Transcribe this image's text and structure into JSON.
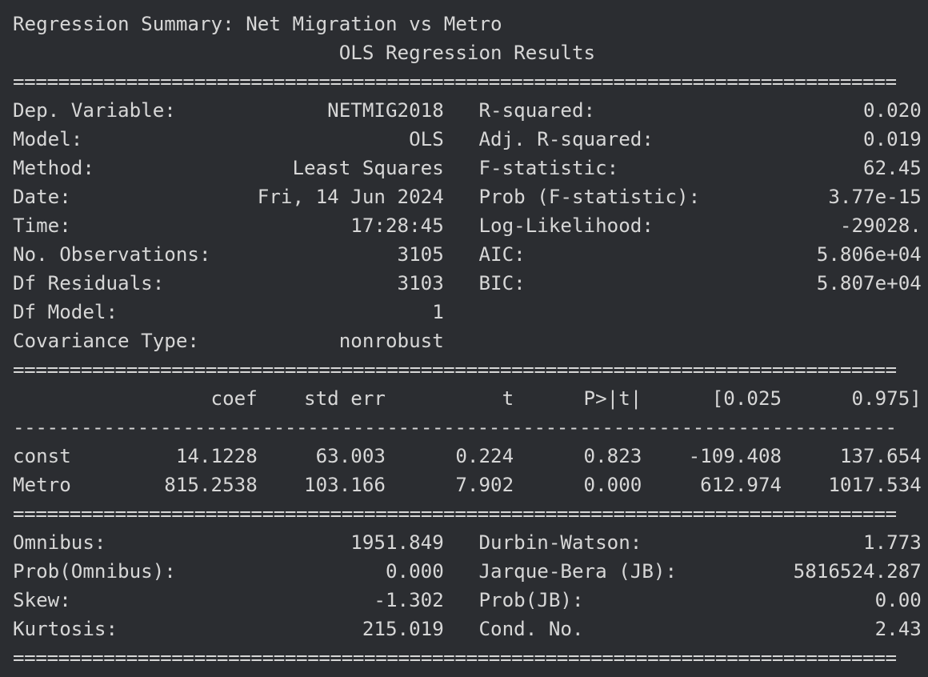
{
  "output_lines": [
    "Regression Summary: Net Migration vs Metro",
    "                            OLS Regression Results                            ",
    "==============================================================================",
    "Dep. Variable:             NETMIG2018   R-squared:                       0.020",
    "Model:                            OLS   Adj. R-squared:                  0.019",
    "Method:                 Least Squares   F-statistic:                     62.45",
    "Date:                Fri, 14 Jun 2024   Prob (F-statistic):           3.77e-15",
    "Time:                        17:28:45   Log-Likelihood:                -29028.",
    "No. Observations:                3105   AIC:                         5.806e+04",
    "Df Residuals:                    3103   BIC:                         5.807e+04",
    "Df Model:                           1                                         ",
    "Covariance Type:            nonrobust                                         ",
    "==============================================================================",
    "                 coef    std err          t      P>|t|      [0.025      0.975]",
    "------------------------------------------------------------------------------",
    "const         14.1228     63.003      0.224      0.823    -109.408     137.654",
    "Metro        815.2538    103.166      7.902      0.000     612.974    1017.534",
    "==============================================================================",
    "Omnibus:                     1951.849   Durbin-Watson:                   1.773",
    "Prob(Omnibus):                  0.000   Jarque-Bera (JB):          5816524.287",
    "Skew:                          -1.302   Prob(JB):                         0.00",
    "Kurtosis:                     215.019   Cond. No.                         2.43",
    "=============================================================================="
  ]
}
